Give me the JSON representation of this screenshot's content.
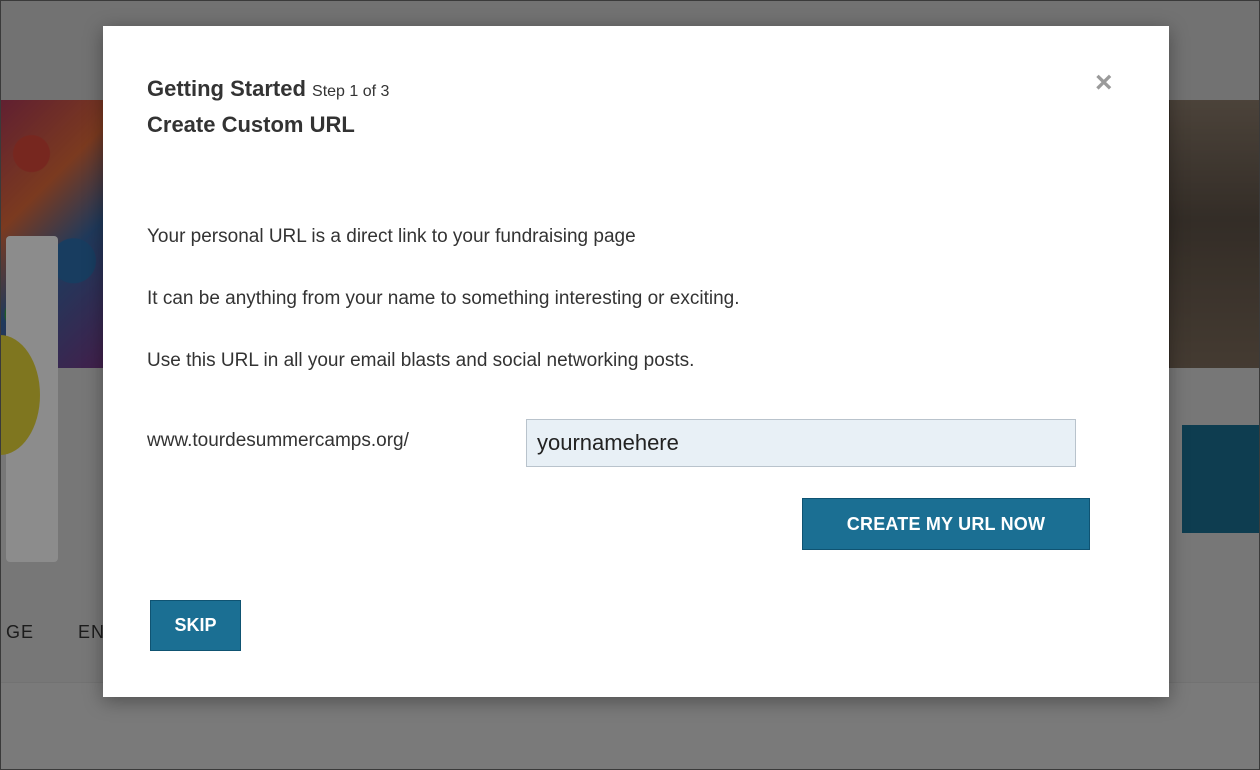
{
  "background": {
    "nav_fragment_left": "GE",
    "nav_fragment_right": "EN"
  },
  "modal": {
    "title": "Getting Started",
    "step": "Step 1 of 3",
    "subtitle": "Create Custom URL",
    "close_icon": "×",
    "paragraphs": [
      "Your personal URL is a direct link to your fundraising page",
      "It can be anything from your name to something interesting or exciting.",
      "Use this URL in all your email blasts and social networking posts."
    ],
    "url_prefix": "www.tourdesummercamps.org/",
    "url_value": "yournamehere",
    "create_button": "CREATE MY URL NOW",
    "skip_button": "SKIP"
  },
  "colors": {
    "accent": "#1b6f93",
    "input_bg": "#e8f0f6"
  }
}
